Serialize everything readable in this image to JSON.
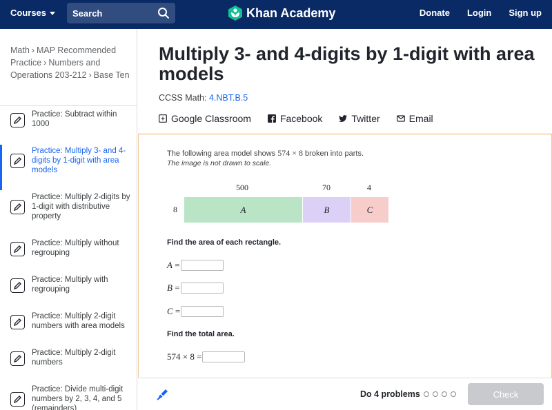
{
  "header": {
    "courses_label": "Courses",
    "search_placeholder": "Search",
    "logo_text": "Khan Academy",
    "donate": "Donate",
    "login": "Login",
    "signup": "Sign up"
  },
  "sidebar": {
    "breadcrumb": [
      "Math",
      "MAP Recommended Practice",
      "Numbers and Operations 203-212",
      "Base Ten"
    ],
    "items": [
      {
        "label": "Practice: Subtract within 1000",
        "active": false
      },
      {
        "label": "Practice: Multiply 3- and 4-digits by 1-digit with area models",
        "active": true
      },
      {
        "label": "Practice: Multiply 2-digits by 1-digit with distributive property",
        "active": false
      },
      {
        "label": "Practice: Multiply without regrouping",
        "active": false
      },
      {
        "label": "Practice: Multiply with regrouping",
        "active": false
      },
      {
        "label": "Practice: Multiply 2-digit numbers with area models",
        "active": false
      },
      {
        "label": "Practice: Multiply 2-digit numbers",
        "active": false
      },
      {
        "label": "Practice: Divide multi-digit numbers by 2, 3, 4, and 5 (remainders)",
        "active": false
      }
    ]
  },
  "main": {
    "title": "Multiply 3- and 4-digits by 1-digit with area models",
    "ccss_prefix": "CCSS Math:",
    "ccss_code": "4.NBT.B.5",
    "share": {
      "google": "Google Classroom",
      "facebook": "Facebook",
      "twitter": "Twitter",
      "email": "Email"
    }
  },
  "exercise": {
    "intro_before": "The following area model shows",
    "intro_math": "574 × 8",
    "intro_after": "broken into parts.",
    "note": "The image is not drawn to scale.",
    "area_model": {
      "height_label": "8",
      "parts": [
        {
          "width": "500",
          "name": "A",
          "color": "#b9e5c6"
        },
        {
          "width": "70",
          "name": "B",
          "color": "#dcd0f7"
        },
        {
          "width": "4",
          "name": "C",
          "color": "#f7cdcb"
        }
      ]
    },
    "find_each": "Find the area of each rectangle.",
    "answers": [
      {
        "var": "A",
        "value": ""
      },
      {
        "var": "B",
        "value": ""
      },
      {
        "var": "C",
        "value": ""
      }
    ],
    "find_total": "Find the total area.",
    "total_expr": "574 × 8"
  },
  "footer": {
    "do_label": "Do 4 problems",
    "problem_count": 4,
    "check_label": "Check"
  },
  "colors": {
    "header_bg": "#0a2a66",
    "accent": "#1865f2",
    "exercise_border": "#f0a85a",
    "check_disabled": "#c8cacd"
  }
}
